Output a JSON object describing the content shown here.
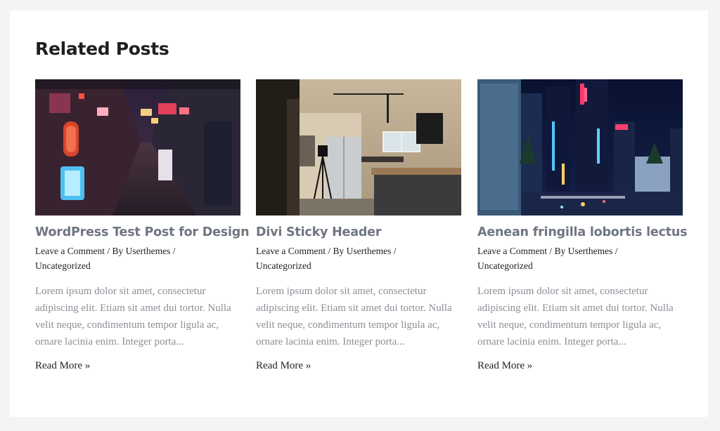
{
  "section": {
    "heading": "Related Posts"
  },
  "posts": [
    {
      "title": "WordPress Test Post for Design",
      "comment_link": "Leave a Comment",
      "by_prefix": "/ By",
      "author": "Userthemes",
      "separator": "/",
      "category": "Uncategorized",
      "excerpt": "Lorem ipsum dolor sit amet, consectetur adipiscing elit. Etiam sit amet dui tortor. Nulla velit neque, condimentum tempor ligula ac, ornare lacinia enim. Integer porta...",
      "read_more": "Read More »",
      "image": "neon-alley-photo"
    },
    {
      "title": "Divi Sticky Header",
      "comment_link": "Leave a Comment",
      "by_prefix": "/ By",
      "author": "Userthemes",
      "separator": "/",
      "category": "Uncategorized",
      "excerpt": "Lorem ipsum dolor sit amet, consectetur adipiscing elit. Etiam sit amet dui tortor. Nulla velit neque, condimentum tempor ligula ac, ornare lacinia enim. Integer porta...",
      "read_more": "Read More »",
      "image": "kitchen-interior-photo"
    },
    {
      "title": "Aenean fringilla lobortis lectus",
      "comment_link": "Leave a Comment",
      "by_prefix": "/ By",
      "author": "Userthemes",
      "separator": "/",
      "category": "Uncategorized",
      "excerpt": "Lorem ipsum dolor sit amet, consectetur adipiscing elit. Etiam sit amet dui tortor. Nulla velit neque, condimentum tempor ligula ac, ornare lacinia enim. Integer porta...",
      "read_more": "Read More »",
      "image": "night-city-photo"
    }
  ],
  "colors": {
    "page_bg": "#f3f4f6",
    "card_bg": "#ffffff",
    "heading": "#1f1f1f",
    "post_title": "#6f7680",
    "excerpt": "#8b8f96",
    "meta": "#222222"
  }
}
